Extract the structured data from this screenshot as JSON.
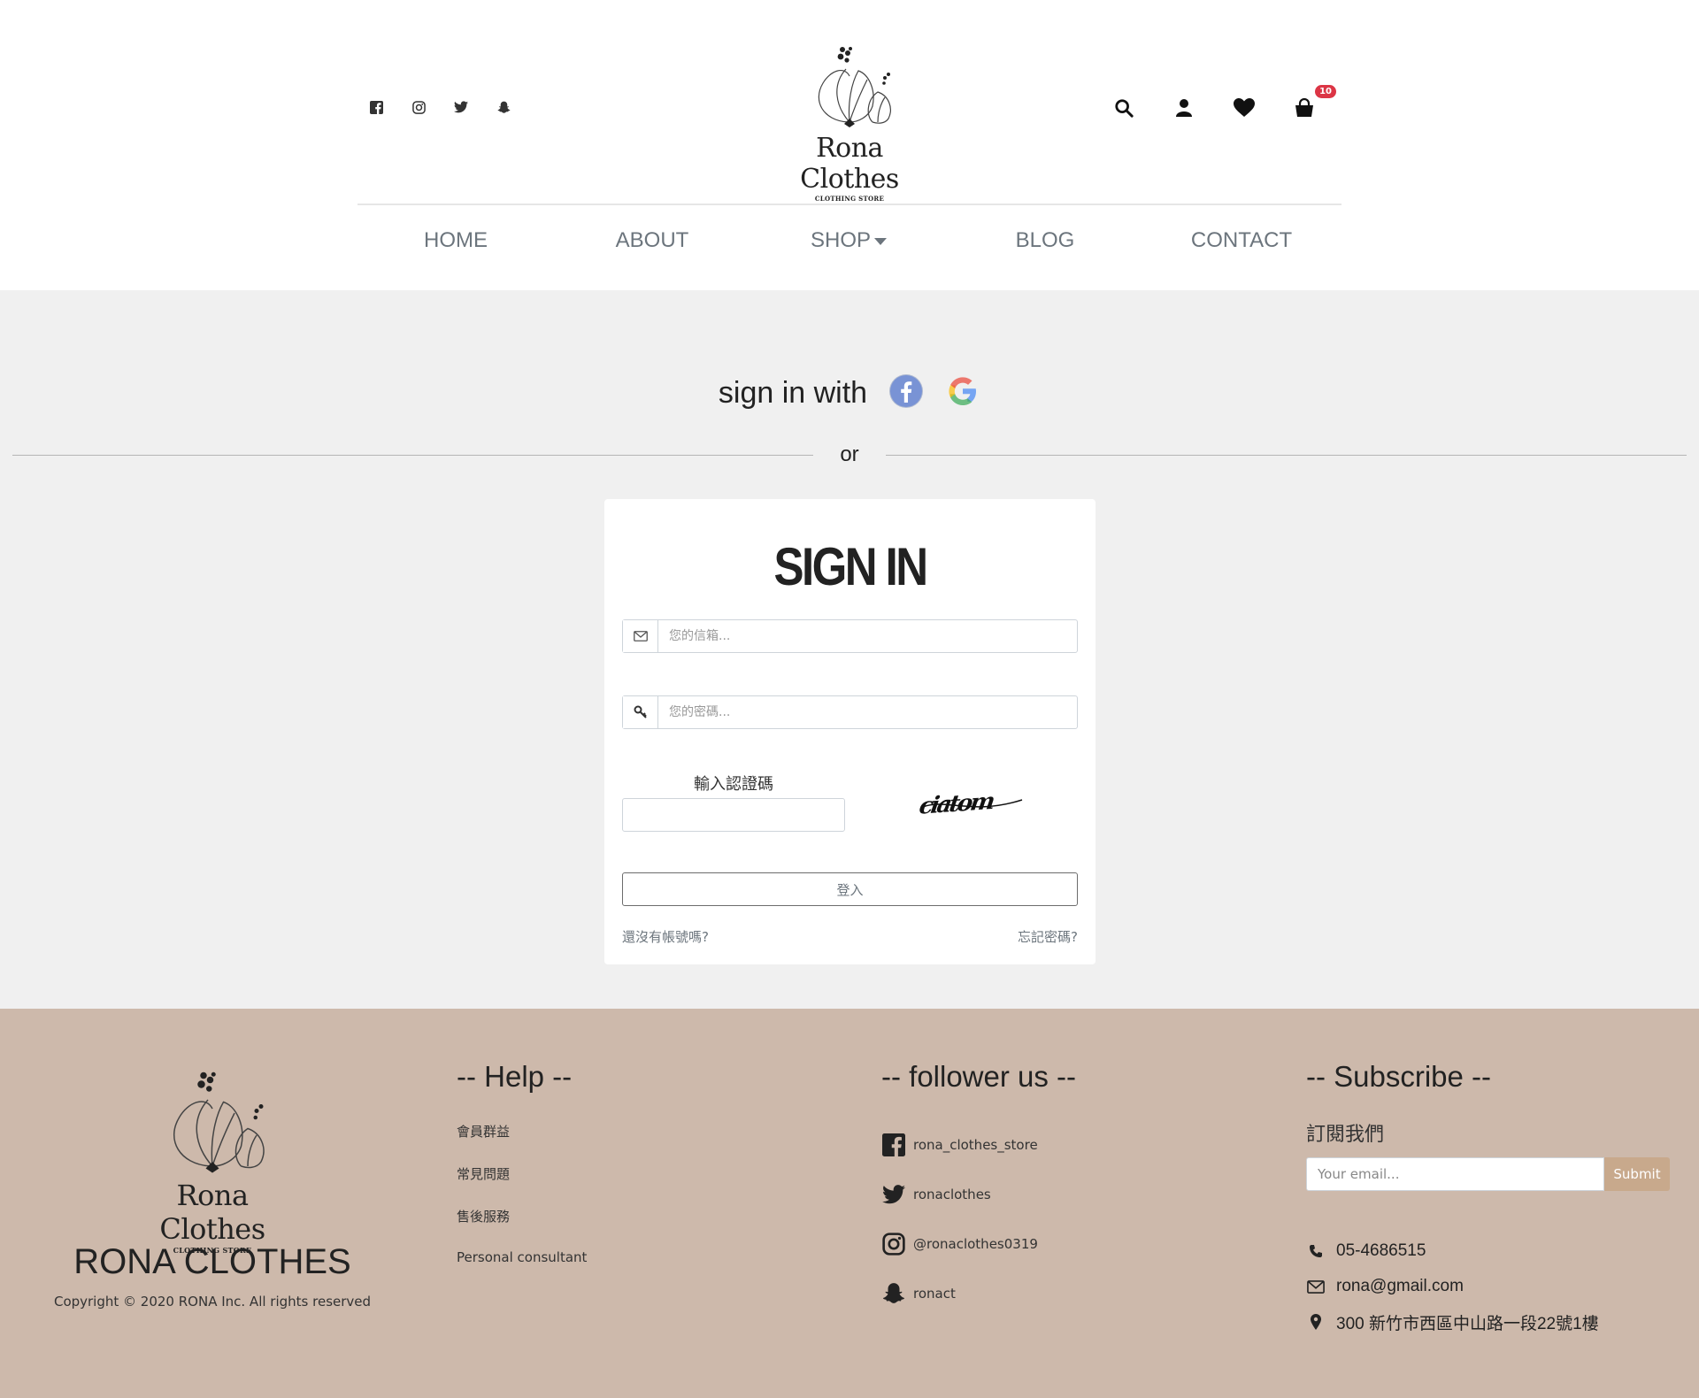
{
  "header": {
    "social": [
      "facebook-icon",
      "instagram-icon",
      "twitter-icon",
      "snapchat-icon"
    ],
    "logo_text": "Rona Clothes",
    "logo_sub": "CLOTHING STORE",
    "cart_count": "10",
    "nav": {
      "home": "HOME",
      "about": "ABOUT",
      "shop": "SHOP",
      "blog": "BLOG",
      "contact": "CONTACT"
    }
  },
  "signin": {
    "with_label": "sign in with",
    "or_label": "or",
    "title": "SIGN IN",
    "email_placeholder": "您的信箱...",
    "password_placeholder": "您的密碼...",
    "captcha_label": "輸入認證碼",
    "captcha_text": "ciatom",
    "login_button": "登入",
    "no_account": "還沒有帳號嗎?",
    "forgot": "忘記密碼?"
  },
  "footer": {
    "logo_text": "Rona Clothes",
    "logo_sub": "CLOTHING STORE",
    "brand": "RONA CLOTHES",
    "copyright": "Copyright © 2020 RONA Inc. All rights reserved",
    "help": {
      "heading": "-- Help --",
      "items": [
        "會員群益",
        "常見問題",
        "售後服務",
        "Personal consultant"
      ]
    },
    "follow": {
      "heading": "-- follower us --",
      "items": [
        "rona_clothes_store",
        "ronaclothes",
        "@ronaclothes0319",
        "ronact"
      ]
    },
    "subscribe": {
      "heading": "-- Subscribe --",
      "label": "訂閱我們",
      "placeholder": "Your email...",
      "button": "Submit",
      "phone": "05-4686515",
      "email": "rona@gmail.com",
      "address": "300 新竹市西區中山路一段22號1樓"
    }
  },
  "colors": {
    "footer_bg": "#cdb9ab",
    "main_bg": "#f0f0f0",
    "badge": "#dc3545",
    "submit": "#c8a98c"
  }
}
